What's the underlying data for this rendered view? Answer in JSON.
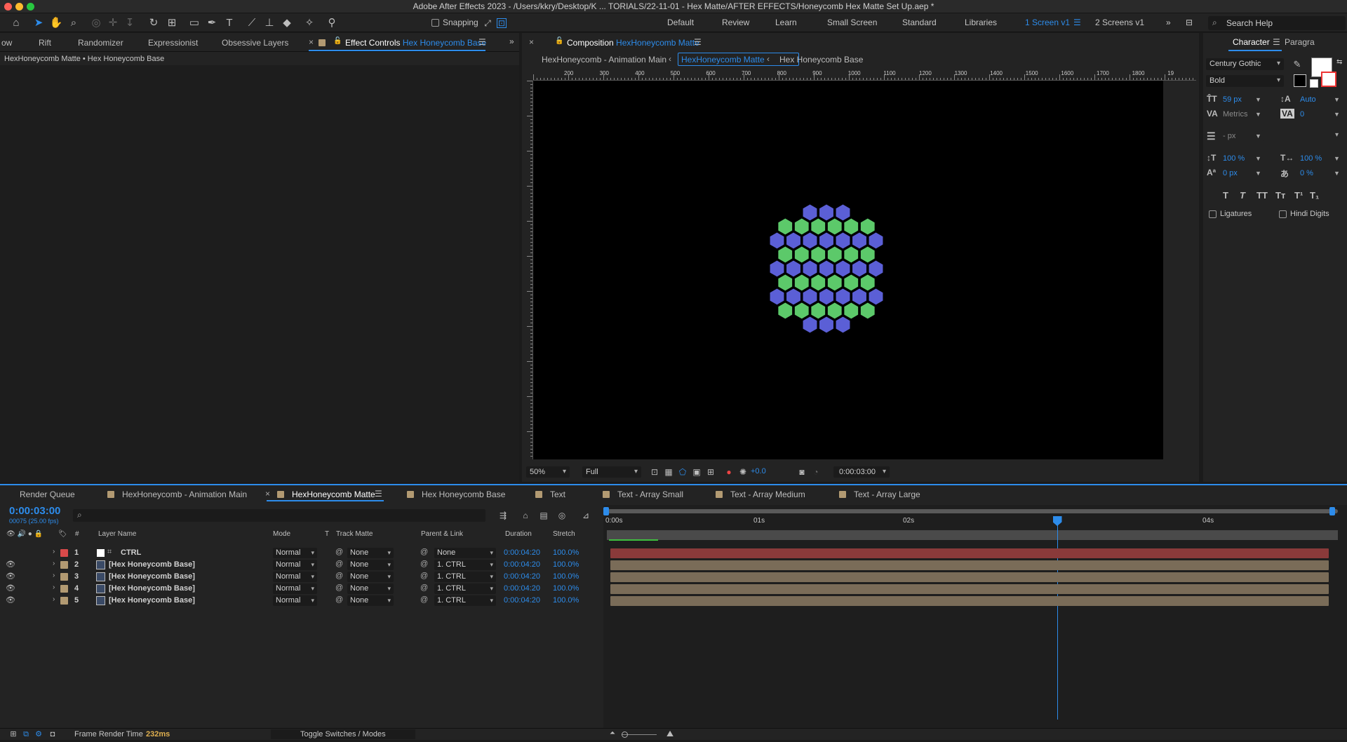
{
  "title_bar": {
    "text": "Adobe After Effects 2023 - /Users/kkry/Desktop/K  ... TORIALS/22-11-01 - Hex Matte/AFTER EFFECTS/Honeycomb Hex Matte Set Up.aep *"
  },
  "toolbar": {
    "snapping_label": "Snapping",
    "workspaces": [
      "Default",
      "Review",
      "Learn",
      "Small Screen",
      "Standard",
      "Libraries",
      "1 Screen v1",
      "2 Screens v1"
    ],
    "active_workspace": "1 Screen v1",
    "search_placeholder": "Search Help",
    "tools": [
      "home-icon",
      "selection-arrow-icon",
      "hand-icon",
      "zoom-icon",
      "orbit-icon",
      "pan-icon",
      "dolly-icon",
      "rotate-icon",
      "pan-behind-icon",
      "rectangle-icon",
      "pen-icon",
      "type-icon",
      "brush-icon",
      "clone-stamp-icon",
      "eraser-icon",
      "roto-brush-icon",
      "puppet-pin-icon"
    ]
  },
  "left_panel": {
    "tabs": [
      "ow",
      "Rift",
      "Randomizer",
      "Expressionist",
      "Obsessive Layers"
    ],
    "active_tab_prefix": "Effect Controls",
    "active_tab_highlight": "Hex Honeycomb Base",
    "breadcrumb": "HexHoneycomb Matte • Hex Honeycomb Base"
  },
  "comp_panel": {
    "tab_prefix": "Composition",
    "tab_highlight": "HexHoneycomb Matte",
    "flow": [
      "HexHoneycomb - Animation Main",
      "HexHoneycomb Matte",
      "Hex Honeycomb Base"
    ],
    "ruler_labels": [
      "200",
      "300",
      "400",
      "500",
      "600",
      "700",
      "800",
      "900",
      "1000",
      "1100",
      "1200",
      "1300",
      "1400",
      "1500",
      "1600",
      "1700",
      "1800",
      "19"
    ],
    "zoom": "50%",
    "resolution": "Full",
    "exposure": "+0.0",
    "timecode": "0:00:03:00",
    "honeycomb": {
      "rows": [
        [
          "b",
          "b",
          "b"
        ],
        [
          "g",
          "g",
          "g",
          "g",
          "g",
          "g"
        ],
        [
          "b",
          "b",
          "b",
          "b",
          "b",
          "b",
          "b"
        ],
        [
          "g",
          "g",
          "g",
          "g",
          "g",
          "g"
        ],
        [
          "b",
          "b",
          "b",
          "b",
          "b",
          "b",
          "b"
        ],
        [
          "g",
          "g",
          "g",
          "g",
          "g",
          "g"
        ],
        [
          "b",
          "b",
          "b",
          "b",
          "b",
          "b",
          "b"
        ],
        [
          "g",
          "g",
          "g",
          "g",
          "g",
          "g"
        ],
        [
          "b",
          "b",
          "b"
        ]
      ],
      "blue": "#5b5fd6",
      "green": "#5cc96a"
    }
  },
  "character_panel": {
    "tab": "Character",
    "tab2": "Paragra",
    "font": "Century Gothic",
    "style": "Bold",
    "size": "59 px",
    "leading": "Auto",
    "kerning": "Metrics",
    "tracking": "0",
    "stroke": "- px",
    "vscale": "100 %",
    "hscale": "100 %",
    "baseline": "0 px",
    "tsume": "0 %",
    "style_buttons": [
      "T",
      "T",
      "TT",
      "Tт",
      "T¹",
      "T₁"
    ],
    "ligatures": "Ligatures",
    "hindi_digits": "Hindi Digits"
  },
  "timeline": {
    "tabs": [
      "Render Queue",
      "HexHoneycomb - Animation Main",
      "HexHoneycomb Matte",
      "Hex Honeycomb Base",
      "Text",
      "Text - Array Small",
      "Text - Array Medium",
      "Text - Array Large"
    ],
    "active_tab": "HexHoneycomb Matte",
    "timecode": "0:00:03:00",
    "frame_info": "00075 (25.00 fps)",
    "columns": [
      "#",
      "Layer Name",
      "Mode",
      "T",
      "Track Matte",
      "Parent & Link",
      "Duration",
      "Stretch"
    ],
    "ruler": [
      "0:00s",
      "01s",
      "02s",
      "04s"
    ],
    "layers": [
      {
        "num": "1",
        "name": "CTRL",
        "mode": "Normal",
        "track": "None",
        "parent": "None",
        "duration": "0:00:04:20",
        "stretch": "100.0%",
        "label": "#d94a4a",
        "bar": "#8a3a3a"
      },
      {
        "num": "2",
        "name": "[Hex Honeycomb Base]",
        "mode": "Normal",
        "track": "None",
        "parent": "1. CTRL",
        "duration": "0:00:04:20",
        "stretch": "100.0%",
        "label": "#b29a72",
        "bar": "#7a6c58"
      },
      {
        "num": "3",
        "name": "[Hex Honeycomb Base]",
        "mode": "Normal",
        "track": "None",
        "parent": "1. CTRL",
        "duration": "0:00:04:20",
        "stretch": "100.0%",
        "label": "#b29a72",
        "bar": "#7a6c58"
      },
      {
        "num": "4",
        "name": "[Hex Honeycomb Base]",
        "mode": "Normal",
        "track": "None",
        "parent": "1. CTRL",
        "duration": "0:00:04:20",
        "stretch": "100.0%",
        "label": "#b29a72",
        "bar": "#7a6c58"
      },
      {
        "num": "5",
        "name": "[Hex Honeycomb Base]",
        "mode": "Normal",
        "track": "None",
        "parent": "1. CTRL",
        "duration": "0:00:04:20",
        "stretch": "100.0%",
        "label": "#b29a72",
        "bar": "#7a6c58"
      }
    ],
    "playhead_seconds": 3.0,
    "frame_render_label": "Frame Render Time",
    "frame_render_value": "232ms",
    "toggle_label": "Toggle Switches / Modes"
  },
  "colors": {
    "accent": "#2d8ceb",
    "panel_bg": "#232323",
    "app_bg": "#1b1b1b"
  }
}
